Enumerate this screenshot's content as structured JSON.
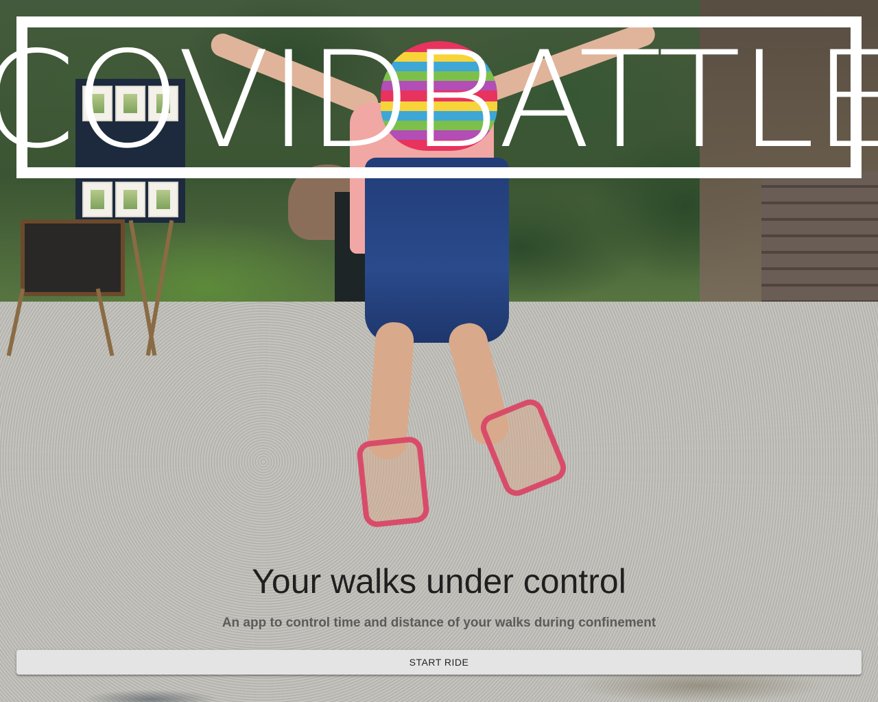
{
  "brand": {
    "logo_text": "COVIDBATTLE",
    "logo_color": "#ffffff"
  },
  "hero": {
    "title": "Your walks under control",
    "subtitle": "An app to control time and distance of your walks during confinement",
    "background_image": "photo of a child jumping on gravel in a park"
  },
  "actions": {
    "start_label": "START RIDE"
  },
  "colors": {
    "title_text": "#1f1f1f",
    "subtitle_text": "#5b5b5b",
    "button_bg": "#e4e4e4",
    "button_text": "#222222"
  }
}
